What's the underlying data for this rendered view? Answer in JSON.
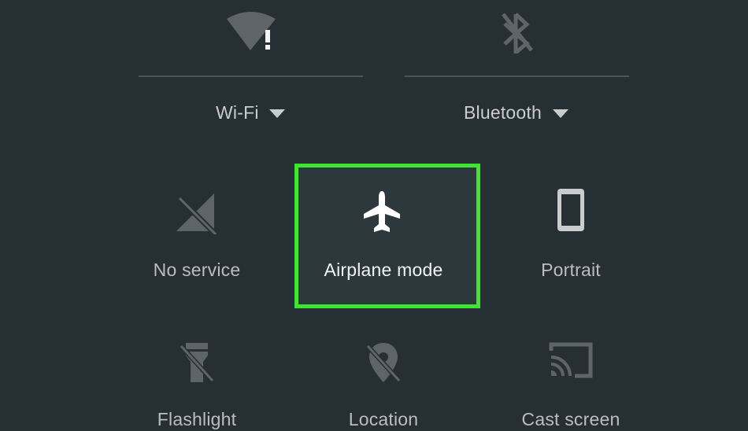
{
  "quick_settings": {
    "wifi": {
      "label": "Wi-Fi",
      "icon": "wifi-warning-icon",
      "has_dropdown": true
    },
    "bluetooth": {
      "label": "Bluetooth",
      "icon": "bluetooth-off-icon",
      "has_dropdown": true
    },
    "tiles": [
      {
        "label": "No service",
        "icon": "no-signal-icon",
        "active": false
      },
      {
        "label": "Airplane mode",
        "icon": "airplane-icon",
        "active": true
      },
      {
        "label": "Portrait",
        "icon": "phone-portrait-icon",
        "active": false
      },
      {
        "label": "Flashlight",
        "icon": "flashlight-off-icon",
        "active": false
      },
      {
        "label": "Location",
        "icon": "location-off-icon",
        "active": false
      },
      {
        "label": "Cast screen",
        "icon": "cast-icon",
        "active": false
      }
    ]
  },
  "colors": {
    "background": "#262f33",
    "highlight": "#3ee62f",
    "icon_dim": "#5d6569",
    "icon_active": "#ffffff"
  }
}
